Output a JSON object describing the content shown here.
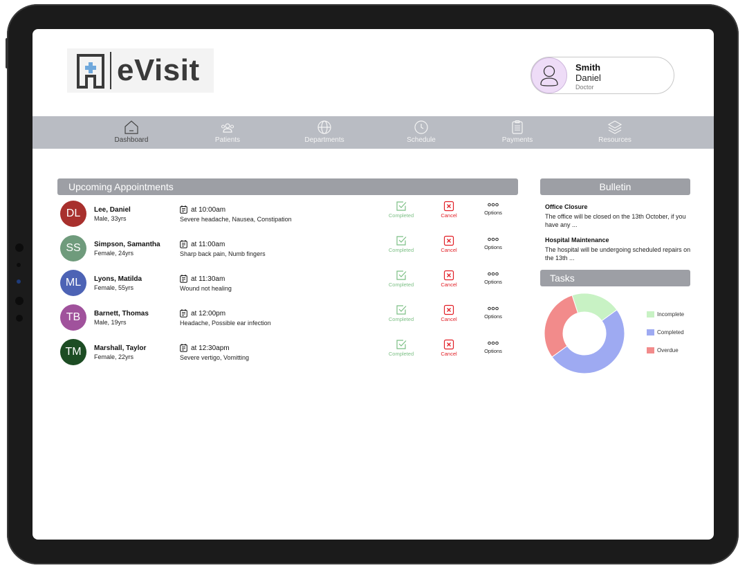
{
  "app": {
    "logo_text": "eVisit"
  },
  "profile": {
    "last_name": "Smith",
    "first_name": "Daniel",
    "role": "Doctor"
  },
  "nav": {
    "items": [
      {
        "label": "Dashboard",
        "icon": "home-icon"
      },
      {
        "label": "Patients",
        "icon": "users-icon"
      },
      {
        "label": "Departments",
        "icon": "globe-icon"
      },
      {
        "label": "Schedule",
        "icon": "clock-icon"
      },
      {
        "label": "Payments",
        "icon": "clipboard-icon"
      },
      {
        "label": "Resources",
        "icon": "layers-icon"
      }
    ],
    "active": "Dashboard"
  },
  "appointments": {
    "title": "Upcoming Appointments",
    "actions": {
      "completed": "Completed",
      "cancel": "Cancel",
      "options": "Options"
    },
    "items": [
      {
        "initials": "DL",
        "name": "Lee, Daniel",
        "info": "Male, 33yrs",
        "time": "at 10:00am",
        "symptoms": "Severe headache, Nausea, Constipation",
        "color": "#a8302d"
      },
      {
        "initials": "SS",
        "name": "Simpson, Samantha",
        "info": "Female, 24yrs",
        "time": "at 11:00am",
        "symptoms": "Sharp back pain, Numb fingers",
        "color": "#6f9b7c"
      },
      {
        "initials": "ML",
        "name": "Lyons, Matilda",
        "info": "Female, 55yrs",
        "time": "at 11:30am",
        "symptoms": "Wound not healing",
        "color": "#4d63b5"
      },
      {
        "initials": "TB",
        "name": "Barnett, Thomas",
        "info": "Male, 19yrs",
        "time": "at 12:00pm",
        "symptoms": "Headache, Possible ear infection",
        "color": "#a0529c"
      },
      {
        "initials": "TM",
        "name": "Marshall, Taylor",
        "info": "Female, 22yrs",
        "time": "at 12:30apm",
        "symptoms": "Severe vertigo, Vomitting",
        "color": "#1d4d24"
      }
    ]
  },
  "bulletin": {
    "title": "Bulletin",
    "items": [
      {
        "title": "Office Closure",
        "body": "The office will be closed on the 13th October, if you have any ..."
      },
      {
        "title": "Hospital Maintenance",
        "body": "The hospital will be undergoing scheduled repairs on the 13th ..."
      }
    ]
  },
  "tasks": {
    "title": "Tasks"
  },
  "chart_data": {
    "type": "pie",
    "donut": true,
    "categories": [
      "Incomplete",
      "Completed",
      "Overdue"
    ],
    "values": [
      20,
      50,
      30
    ],
    "colors": [
      "#c8f2c4",
      "#9eaaf2",
      "#f28b8b"
    ],
    "legend": "right"
  }
}
